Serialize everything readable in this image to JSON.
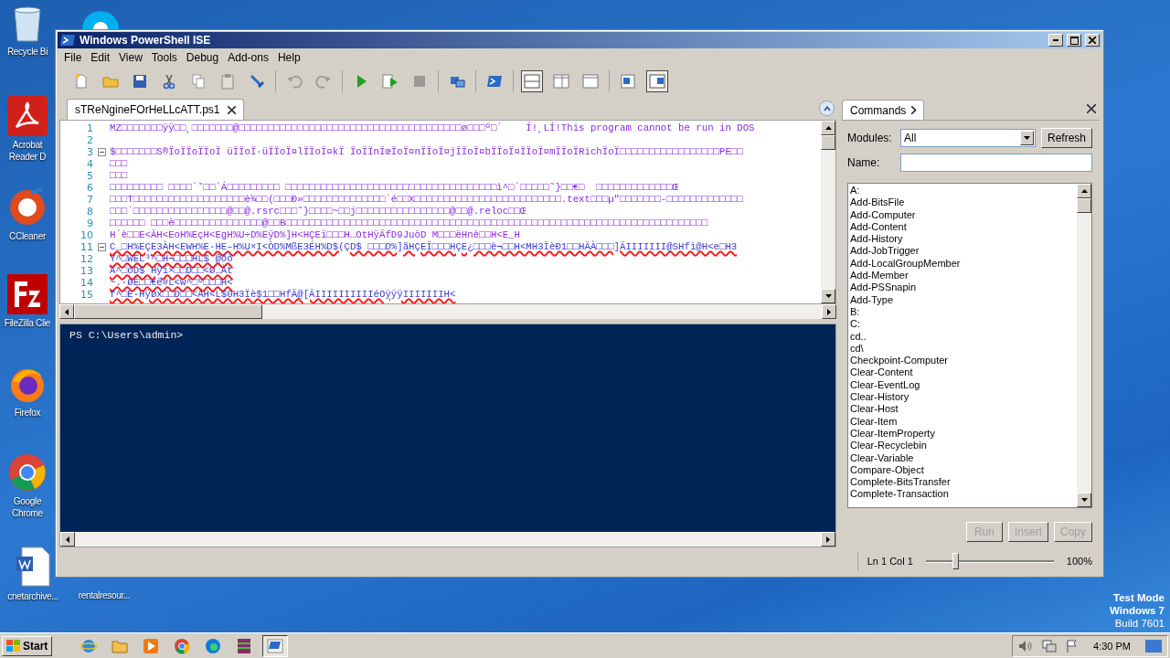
{
  "desktop": {
    "icons": [
      {
        "kind": "recycle",
        "label": "Recycle Bi"
      },
      {
        "kind": "skype"
      },
      {
        "kind": "acrobat",
        "label": "Acrobat Reader D"
      },
      {
        "kind": "ccleaner",
        "label": "CCleaner"
      },
      {
        "kind": "filezilla",
        "label": "FileZilla Clie"
      },
      {
        "kind": "firefox",
        "label": "Firefox"
      },
      {
        "kind": "chrome",
        "label": "Google Chrome"
      },
      {
        "kind": "word",
        "label": "cnetarchive..."
      },
      {
        "kind": "covered",
        "label": "rentalresour..."
      }
    ],
    "notice": [
      "Test Mode",
      "Windows 7",
      "Build 7601"
    ]
  },
  "window": {
    "title": "Windows PowerShell ISE",
    "menu": [
      "File",
      "Edit",
      "View",
      "Tools",
      "Debug",
      "Add-ons",
      "Help"
    ],
    "toolbar": [
      [
        {
          "kind": "new",
          "disabled": false,
          "pressed": false
        },
        {
          "kind": "open",
          "disabled": false,
          "pressed": false
        },
        {
          "kind": "save",
          "disabled": false,
          "pressed": false
        },
        {
          "kind": "cut",
          "disabled": false,
          "pressed": false
        },
        {
          "kind": "copy",
          "disabled": false,
          "pressed": false
        },
        {
          "kind": "paste",
          "disabled": false,
          "pressed": false
        },
        {
          "kind": "clear",
          "disabled": false,
          "pressed": false
        }
      ],
      [
        {
          "kind": "undo",
          "disabled": true,
          "pressed": false
        },
        {
          "kind": "redo",
          "disabled": true,
          "pressed": false
        }
      ],
      [
        {
          "kind": "run",
          "disabled": false,
          "pressed": false
        },
        {
          "kind": "run-selection",
          "disabled": false,
          "pressed": false
        },
        {
          "kind": "stop",
          "disabled": true,
          "pressed": false
        }
      ],
      [
        {
          "kind": "remote",
          "disabled": false,
          "pressed": false
        }
      ],
      [
        {
          "kind": "powershell",
          "disabled": false,
          "pressed": false
        }
      ],
      [
        {
          "kind": "layout-top",
          "disabled": false,
          "pressed": true
        },
        {
          "kind": "layout-right",
          "disabled": false,
          "pressed": false
        },
        {
          "kind": "layout-max",
          "disabled": false,
          "pressed": false
        }
      ],
      [
        {
          "kind": "show-script",
          "disabled": false,
          "pressed": false
        },
        {
          "kind": "show-commands",
          "disabled": false,
          "pressed": true
        }
      ]
    ],
    "editor": {
      "tabs": [
        {
          "label": "sTReNgineFOrHeLLcATT.ps1",
          "selected": true
        }
      ],
      "lines": [
        {
          "number": "1",
          "text": "MZ□□□□□□□ÿÿ□□¸□□□□□□□@□□□□□□□□□□□□□□□□□□□□□□□□□□□□□□□□□□□□□□ø□□□º□´    Í!¸LÍ!This program cannot be run in DOS",
          "fold": false,
          "error": false
        },
        {
          "number": "2",
          "fold": false
        },
        {
          "number": "3",
          "text": "$□□□□□□□S®ÏoÏÏoÏÏoÏ üÏÏoÏ·üÏÏoÏ¤lÏÏoÏ¤kÏ ÏoÏÏnÏœÏoÏ¤nÏÏoÏ¤jÏÏoÏ¤bÏÏoÏ¤ÏÏoÏ¤mÏÏoÏRichÏoÏ□□□□□□□□□□□□□□□□□PE□□",
          "fold": true,
          "error": false
        },
        {
          "number": "4",
          "text": "□□□",
          "fold": false,
          "error": false
        },
        {
          "number": "5",
          "text": "□□□",
          "fold": false,
          "error": false
        },
        {
          "number": "6",
          "text": "□□□□□□□□□ □□□□´˜□□`Á□□□□□□□□□ □□□□□□□□□□□□□□□□□□□□□□□□□□□□□□□□□□□□ì^□´□□□□□˜}□□€□  □□□□□□□□□□□□□Œ",
          "fold": false,
          "error": false
        },
        {
          "number": "7",
          "text": "□□□T□□□□□□□□□□□□□□□□□□□è¾□□(□□□Ð»□□□□□□□□□□□□□□`é□□X□□□□□□□□□□□□□□□□□□□□□□□□□.text□□□µ\"□□□□□□□-□□□□□□□□□□□□□",
          "fold": false,
          "error": false
        },
        {
          "number": "8",
          "text": "□□□`□□□□□□□□□□□□□□□□@□□@.rsrc□□□˜}□□□□~□□j□□□□□□□□□□□□□□□□@□□@.reloc□□Œ",
          "fold": false,
          "error": false
        },
        {
          "number": "9",
          "text": "□□□□□□ □□□è□□□□□□□□□□□□□□□@□□B□□□□□□□□□□□□□□□□□□□□□□□□□□□□□□□□□□□□□□□□□□□□□□□□□□□□□□□□□□□□□□□□□□□□□□□□",
          "fold": false,
          "error": false
        },
        {
          "number": "10",
          "text": "H´è□□E<ÄH<EoH%EçH<EgH%U÷D%EÿD%]H<HÇEï□□□H…OtHÿÄfD9JuöD M□□□ëHnè□□H<E_H",
          "fold": false,
          "error": false
        },
        {
          "number": "11",
          "text": "C_□H%EÇE3ÀH<EWH%E·HE–H%U×I<ÒD%MßE3ÉH%D$(ÇD$ □□□D%]ãHÇEÏ□□□HÇE¿□□□è¬□□H<MH3ÏèÐ1□□HÄÀ□□□]ÄIIIIIII@SHfì@H<e□H3",
          "fold": true,
          "error": true
        },
        {
          "number": "12",
          "text": "Ÿ^□WEL³^□H¬□□□HL$ @ðó",
          "fold": false,
          "error": true
        },
        {
          "number": "13",
          "text": "Ä^□óD$ Hÿî×□□D□□<Ø…Àt",
          "fold": false,
          "error": true
        },
        {
          "number": "14",
          "text": "~.·ØÊ□□€ë#L<w^□º□□□H<",
          "fold": false,
          "error": true
        },
        {
          "number": "15",
          "text": "f^□E·Hÿøx□□D□□<ÄH<L$0H3Ïè$1□□HfÄ@[ÄIIIIIIIIIIéOÿÿÿIIIIIIIH<",
          "fold": false,
          "error": true
        }
      ]
    },
    "console": {
      "prompt": "PS C:\\Users\\admin>"
    },
    "commands": {
      "tab": "Commands",
      "modules_label": "Modules:",
      "modules_value": "All",
      "refresh": "Refresh",
      "name_label": "Name:",
      "items": [
        "A:",
        "Add-BitsFile",
        "Add-Computer",
        "Add-Content",
        "Add-History",
        "Add-JobTrigger",
        "Add-LocalGroupMember",
        "Add-Member",
        "Add-PSSnapin",
        "Add-Type",
        "B:",
        "C:",
        "cd..",
        "cd\\",
        "Checkpoint-Computer",
        "Clear-Content",
        "Clear-EventLog",
        "Clear-History",
        "Clear-Host",
        "Clear-Item",
        "Clear-ItemProperty",
        "Clear-Recyclebin",
        "Clear-Variable",
        "Compare-Object",
        "Complete-BitsTransfer",
        "Complete-Transaction"
      ],
      "buttons": [
        {
          "label": "Run",
          "disabled": true
        },
        {
          "label": "Insert",
          "disabled": true
        },
        {
          "label": "Copy",
          "disabled": true
        }
      ]
    },
    "status": {
      "position": "Ln 1  Col 1",
      "zoom": {
        "level": 0.23,
        "reading": "100%"
      }
    }
  },
  "taskbar": {
    "start": "Start",
    "apps": [
      {
        "kind": "ie",
        "selected": false
      },
      {
        "kind": "explorer",
        "selected": false
      },
      {
        "kind": "media",
        "selected": false
      },
      {
        "kind": "chrome",
        "selected": false
      },
      {
        "kind": "edge",
        "selected": false
      },
      {
        "kind": "archive",
        "selected": false
      },
      {
        "kind": "powershell",
        "selected": true
      }
    ],
    "tray": {
      "clock": "4:30 PM"
    }
  }
}
